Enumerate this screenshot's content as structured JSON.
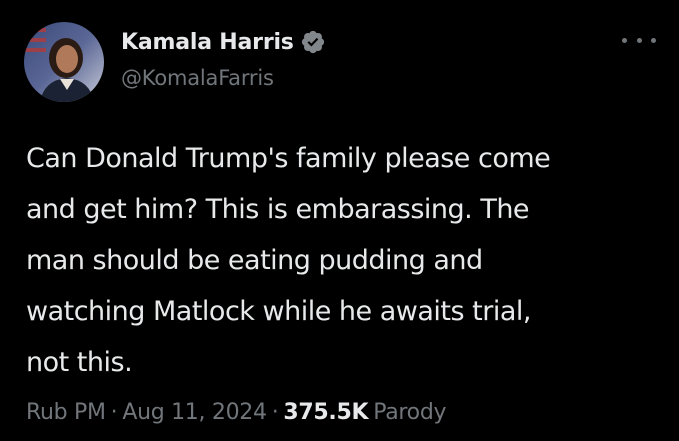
{
  "author": {
    "display_name": "Kamala Harris",
    "handle": "@KomalaFarris",
    "verified": true,
    "avatar": "avatar-photo"
  },
  "tweet": {
    "lines": [
      "Can Donald Trump's family please come",
      "and get him? This is embarassing. The",
      "man should be eating pudding and",
      "watching Matlock while he awaits trial,",
      "not this."
    ]
  },
  "meta": {
    "time": "Rub PM",
    "separator": "·",
    "date": "Aug 11, 2024",
    "views_count": "375.5K",
    "views_label": "Parody"
  },
  "icons": {
    "verified": "verified-badge-icon",
    "more": "more-options-icon"
  },
  "colors": {
    "background": "#000000",
    "primary_text": "#e7e9ea",
    "secondary_text": "#71767b",
    "verified_badge": "#82878c"
  }
}
